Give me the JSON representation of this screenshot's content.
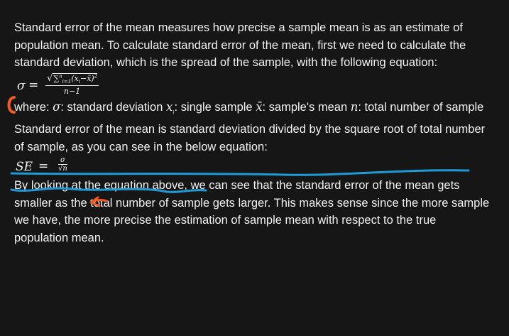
{
  "paragraphs": {
    "intro": "Standard error of the mean measures how precise a sample mean is as an estimate of population mean. To calculate standard error of the mean, first we need to calculate the standard deviation, which is the spread of the sample, with the following equation:",
    "where_label": "where: ",
    "where_sd": ": standard deviation ",
    "where_xi": ": single sample ",
    "where_xbar": ": sample's mean ",
    "where_n": ": total number of sample",
    "se_statement": "Standard error of the mean is standard deviation divided by the square root of total number of sample, as you can see in the below equation:",
    "conclusion": "By looking at the equation above, we can see that the standard error of the mean gets smaller as the total number of sample gets larger. This makes sense since the more sample we have, the more precise the estimation of sample mean with respect to the true population mean."
  },
  "equations": {
    "sigma": {
      "lhs": "σ",
      "equals": "=",
      "sqrt_symbol": "√",
      "sum": "∑",
      "sum_upper": "n",
      "sum_lower": "i=1",
      "term": "(x",
      "term_sub": "i",
      "term_rest": "−x̄)",
      "term_power": "2",
      "denominator": "n−1"
    },
    "se": {
      "lhs": "SE",
      "equals": "=",
      "numerator": "σ",
      "sqrt_symbol": "√",
      "denominator": "n"
    },
    "symbols": {
      "sigma": "σ",
      "xi_base": "x",
      "xi_sub": "i",
      "xbar": "x̄",
      "n": "n"
    }
  },
  "annotations": {
    "color_orange": "#f25a1f",
    "color_blue": "#1e9ad6"
  }
}
